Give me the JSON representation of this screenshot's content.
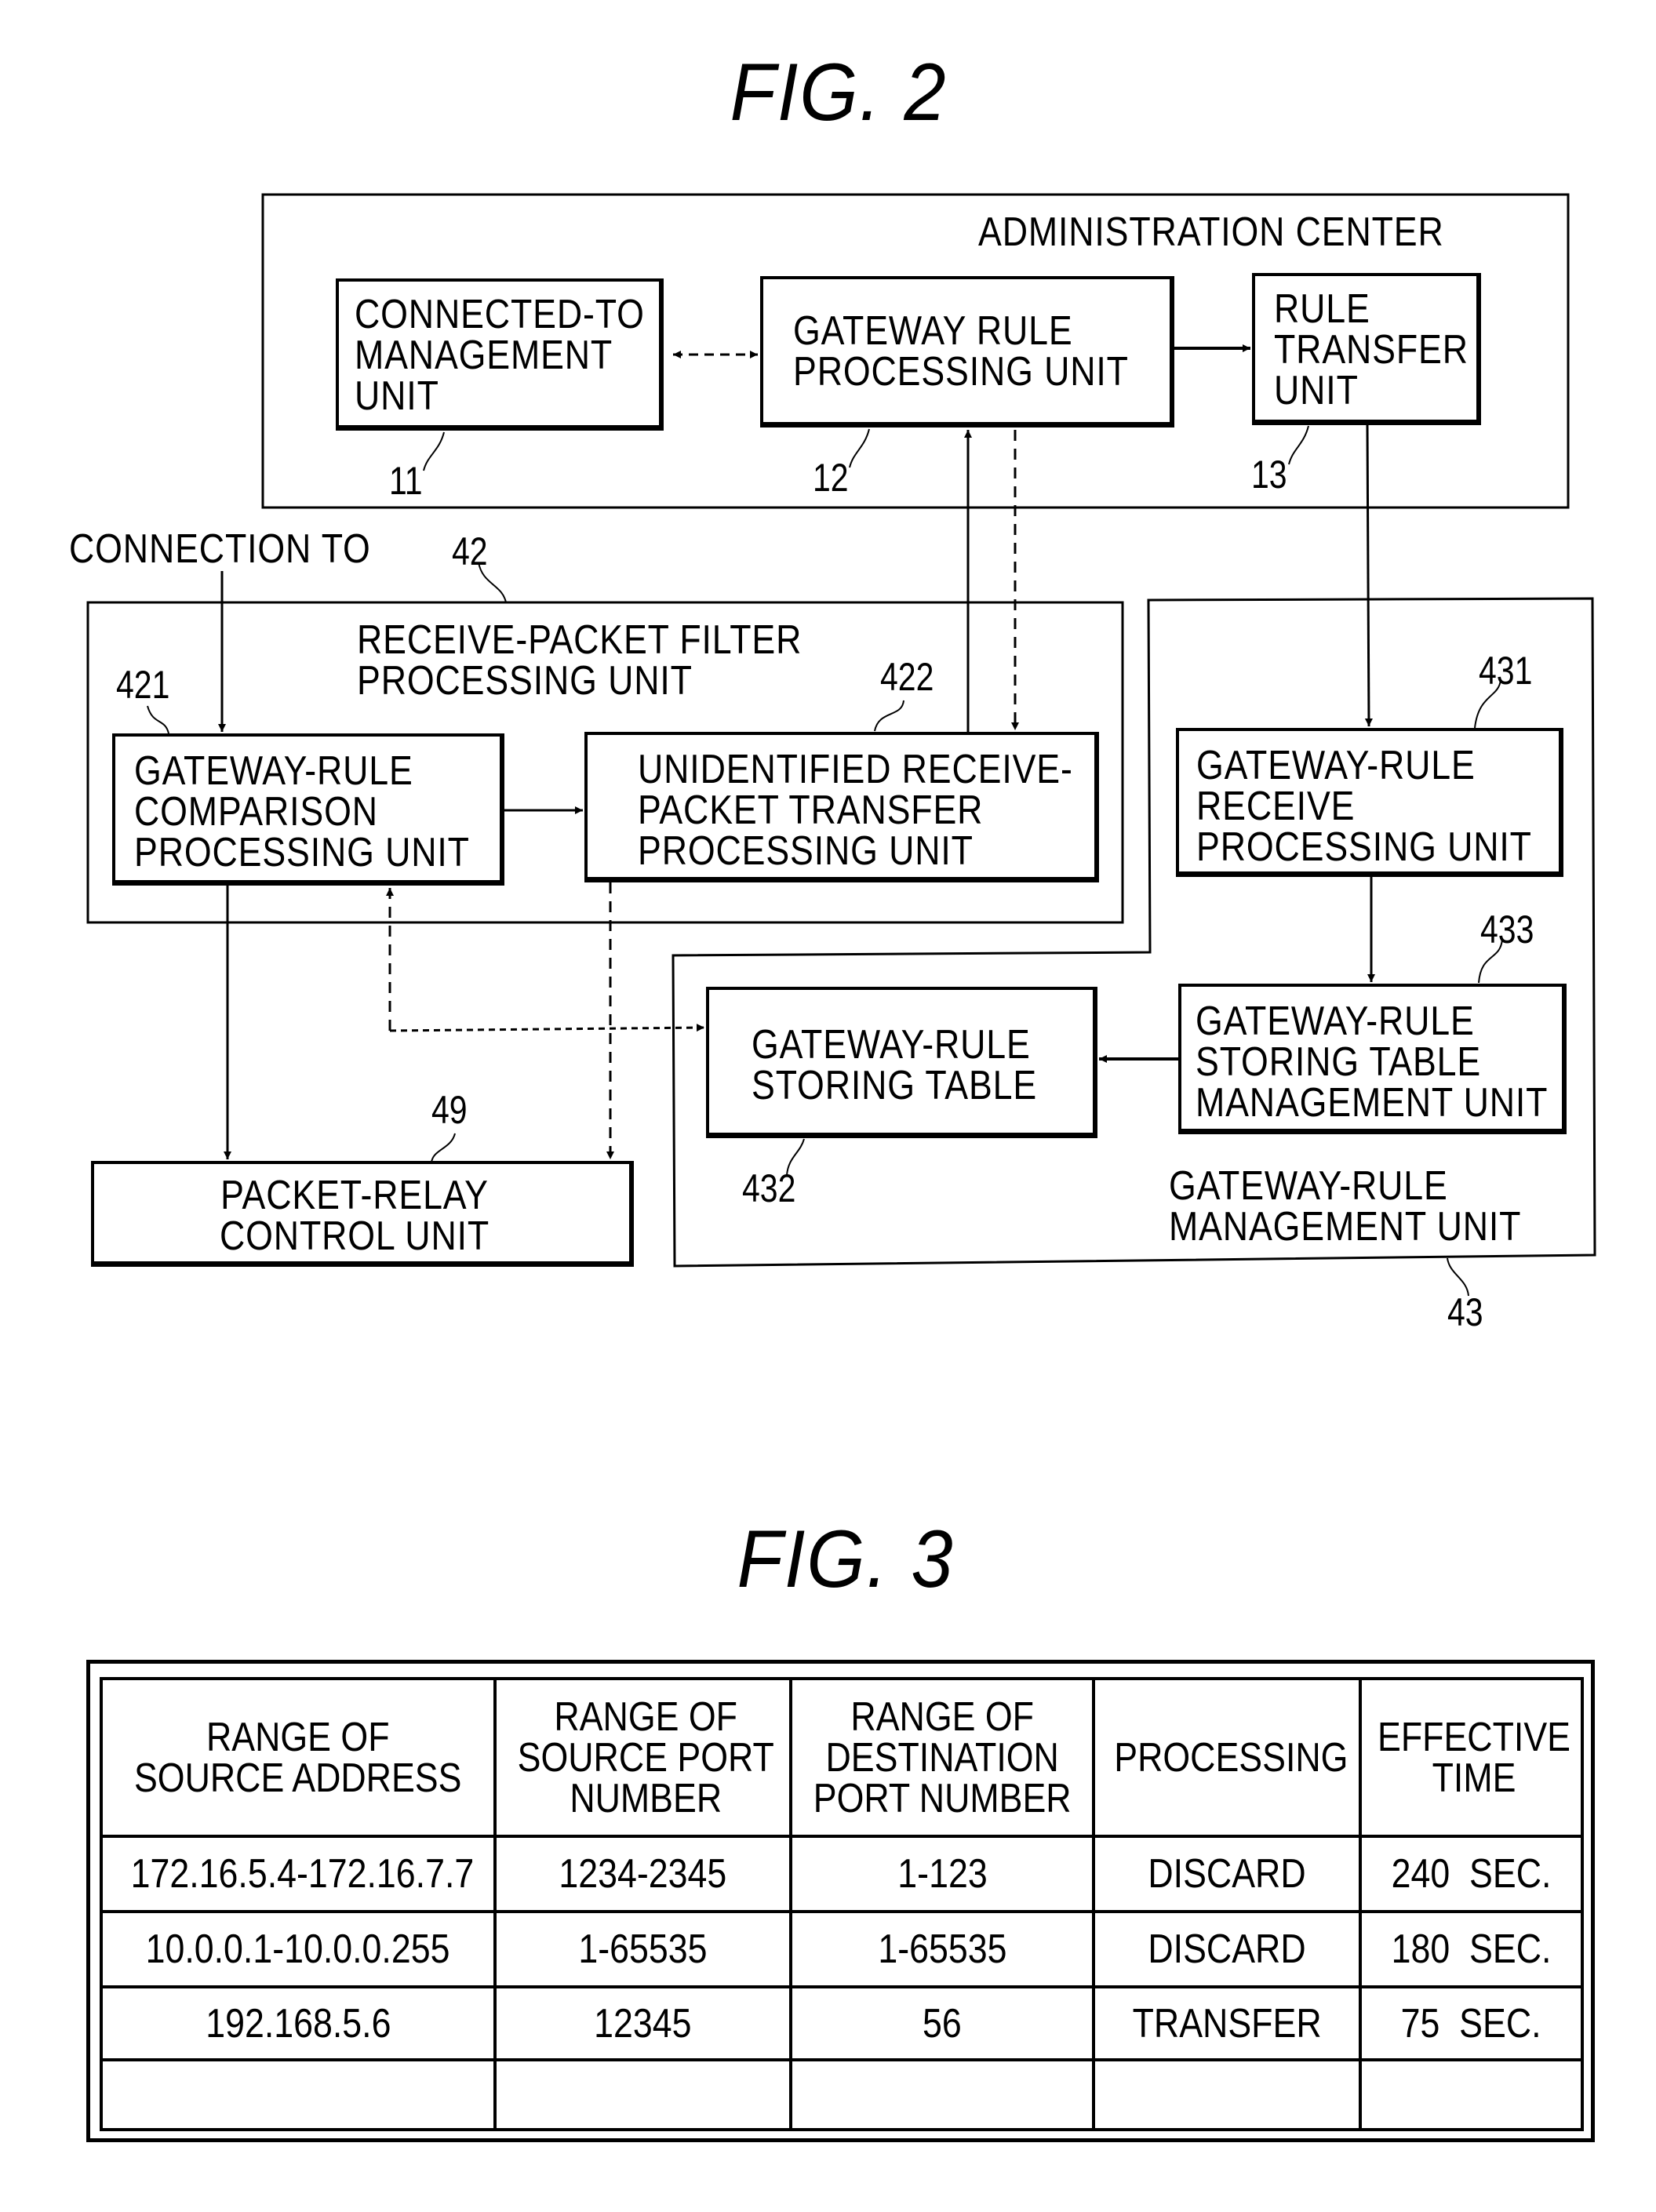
{
  "fig2": {
    "title": "FIG.  2",
    "administration_center": {
      "label": "ADMINISTRATION CENTER",
      "units": [
        {
          "ref": "11",
          "label": "CONNECTED-TO\nMANAGEMENT\nUNIT"
        },
        {
          "ref": "12",
          "label": "GATEWAY RULE\nPROCESSING UNIT"
        },
        {
          "ref": "13",
          "label": "RULE\nTRANSFER\nUNIT"
        }
      ]
    },
    "connection_label": "CONNECTION TO",
    "receive_packet_filter": {
      "ref": "42",
      "label": "RECEIVE-PACKET FILTER\nPROCESSING UNIT",
      "units": [
        {
          "ref": "421",
          "label": "GATEWAY-RULE\nCOMPARISON\nPROCESSING UNIT"
        },
        {
          "ref": "422",
          "label": "UNIDENTIFIED RECEIVE-\nPACKET TRANSFER\nPROCESSING UNIT"
        }
      ]
    },
    "gateway_rule_management": {
      "ref": "43",
      "label": "GATEWAY-RULE\nMANAGEMENT UNIT",
      "units": [
        {
          "ref": "431",
          "label": "GATEWAY-RULE\nRECEIVE\nPROCESSING UNIT"
        },
        {
          "ref": "432",
          "label": "GATEWAY-RULE\nSTORING TABLE"
        },
        {
          "ref": "433",
          "label": "GATEWAY-RULE\nSTORING TABLE\nMANAGEMENT UNIT"
        }
      ]
    },
    "packet_relay": {
      "ref": "49",
      "label": "PACKET-RELAY\nCONTROL UNIT"
    },
    "connections": [
      {
        "from": "11",
        "to": "12",
        "style": "dashed",
        "bidirectional": true
      },
      {
        "from": "12",
        "to": "13",
        "style": "solid"
      },
      {
        "from": "13",
        "to": "431",
        "style": "solid"
      },
      {
        "from": "422",
        "to": "12",
        "style": "solid"
      },
      {
        "from": "12",
        "to": "422",
        "style": "dashed"
      },
      {
        "from": "connection",
        "to": "421",
        "style": "solid"
      },
      {
        "from": "421",
        "to": "422",
        "style": "solid"
      },
      {
        "from": "421",
        "to": "49",
        "style": "solid"
      },
      {
        "from": "422",
        "to": "49",
        "style": "dashed"
      },
      {
        "from": "432",
        "to": "421",
        "style": "dashed"
      },
      {
        "from": "421",
        "to": "432",
        "style": "dashed"
      },
      {
        "from": "431",
        "to": "433",
        "style": "solid"
      },
      {
        "from": "433",
        "to": "432",
        "style": "solid"
      }
    ]
  },
  "fig3": {
    "title": "FIG.  3",
    "table": {
      "headers": [
        "RANGE OF\nSOURCE ADDRESS",
        "RANGE OF\nSOURCE PORT\nNUMBER",
        "RANGE OF\nDESTINATION\nPORT NUMBER",
        "PROCESSING",
        "EFFECTIVE\nTIME"
      ],
      "rows": [
        [
          "172.16.5.4-172.16.7.7",
          "1234-2345",
          "1-123",
          "DISCARD",
          "240  SEC."
        ],
        [
          "10.0.0.1-10.0.0.255",
          "1-65535",
          "1-65535",
          "DISCARD",
          "180  SEC."
        ],
        [
          "192.168.5.6",
          "12345",
          "56",
          "TRANSFER",
          "75  SEC."
        ],
        [
          "",
          "",
          "",
          "",
          ""
        ]
      ]
    }
  }
}
